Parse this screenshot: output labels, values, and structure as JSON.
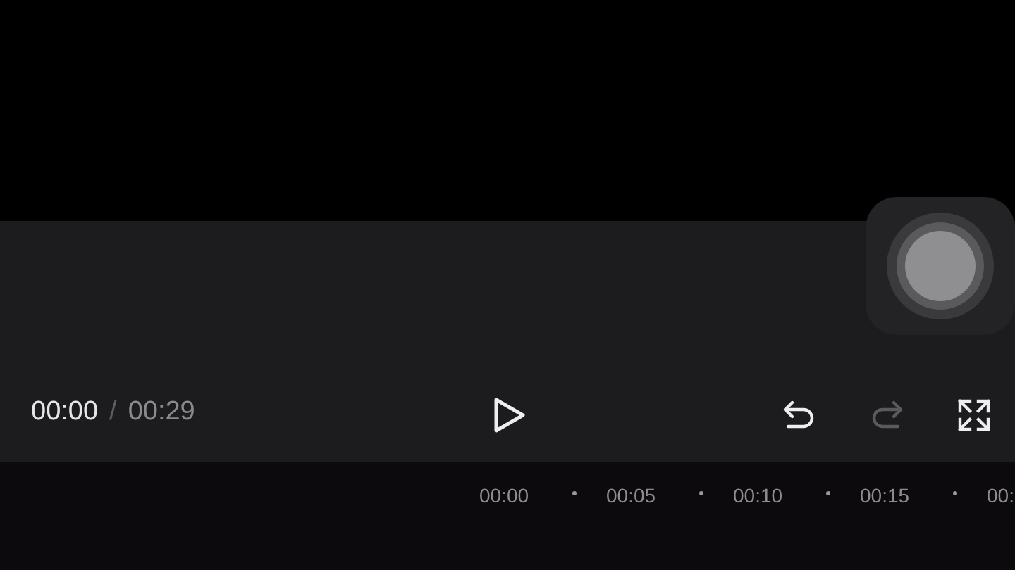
{
  "player": {
    "current_time": "00:00",
    "separator": "/",
    "duration": "00:29"
  },
  "controls": [
    {
      "kind": "undo",
      "disabled": false
    },
    {
      "kind": "redo",
      "disabled": true
    },
    {
      "kind": "fullscreen",
      "disabled": false
    }
  ],
  "timeline": {
    "ticks": [
      "00:00",
      "00:05",
      "00:10",
      "00:15",
      "00:"
    ]
  }
}
